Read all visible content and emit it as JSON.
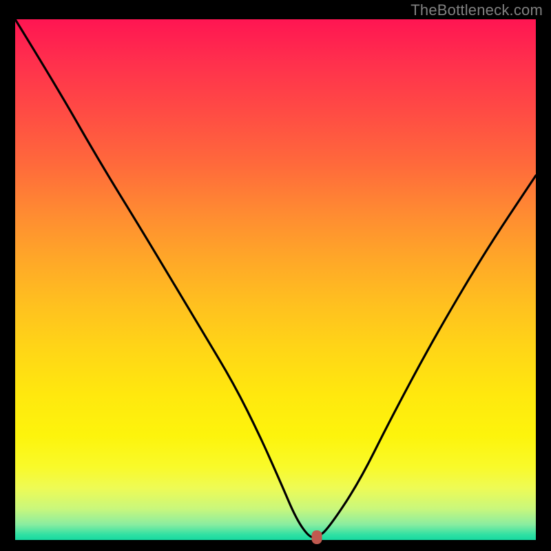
{
  "attribution": "TheBottleneck.com",
  "colors": {
    "curve": "#000000",
    "marker": "#c0594f",
    "frame": "#000000"
  },
  "chart_data": {
    "type": "line",
    "title": "",
    "xlabel": "",
    "ylabel": "",
    "xlim": [
      0,
      100
    ],
    "ylim": [
      0,
      100
    ],
    "grid": false,
    "series": [
      {
        "name": "bottleneck-curve",
        "x": [
          0,
          8,
          16,
          24,
          30,
          36,
          42,
          47,
          51,
          54,
          56.5,
          58,
          60,
          66,
          72,
          80,
          90,
          100
        ],
        "values": [
          100,
          87,
          73,
          60,
          50,
          40,
          30,
          20,
          11,
          4,
          0.5,
          0.5,
          2,
          11,
          23,
          38,
          55,
          70
        ]
      }
    ],
    "marker": {
      "x": 58,
      "y": 0.5
    },
    "notes": "x is horizontal position (percent of plot width); values are bottleneck percent (0 = bottom/green, 100 = top/red). Curve forms a V with minimum plateau near x≈56.5–58."
  }
}
